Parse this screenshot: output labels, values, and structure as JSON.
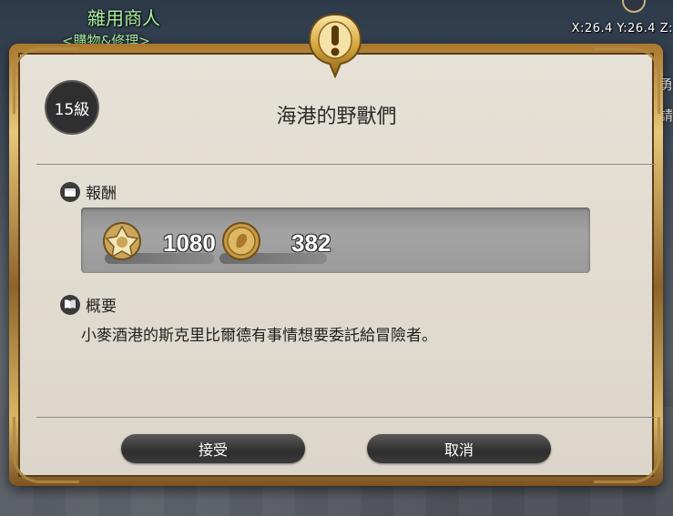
{
  "hud": {
    "npc_name": "雜用商人",
    "npc_subtitle": "<購物&修理>",
    "coordinates": "X:26.4 Y:26.4 Z:",
    "side_text_1": "勇",
    "side_text_2": "請"
  },
  "dialog": {
    "level": "15級",
    "title": "海港的野獸們",
    "reward_label": "報酬",
    "rewards": [
      {
        "icon": "experience-icon",
        "value": "1080"
      },
      {
        "icon": "gil-coin-icon",
        "value": "382"
      }
    ],
    "summary_label": "概要",
    "summary_text": "小麥酒港的斯克里比爾德有事情想要委託給冒險者。",
    "accept_label": "接受",
    "cancel_label": "取消"
  },
  "colors": {
    "frame_gold": "#d9b767",
    "panel_bg": "#e3ded3",
    "button_dark": "#2e2e2e",
    "npc_name_green": "#a8f0a0"
  }
}
